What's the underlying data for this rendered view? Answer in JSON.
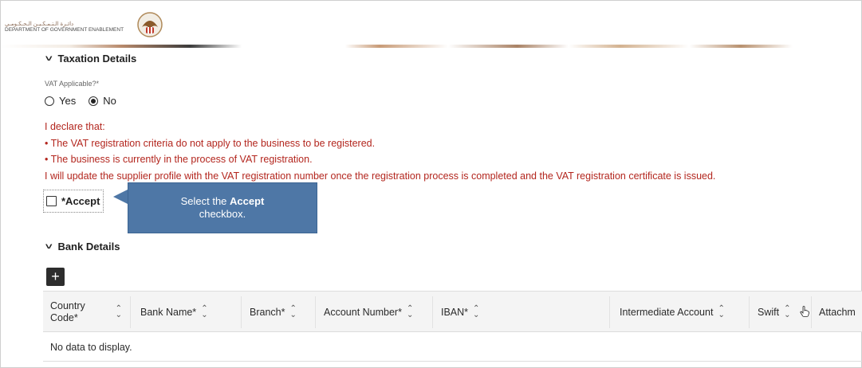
{
  "header": {
    "brand_arabic": "دائـرة الـتـمـكـيـن الـحـكـومـي",
    "brand_english": "DEPARTMENT OF GOVERNMENT ENABLEMENT",
    "emblem_icon": "falcon-emblem-icon"
  },
  "taxation": {
    "section_title": "Taxation Details",
    "vat_label": "VAT Applicable?*",
    "options": [
      "Yes",
      "No"
    ],
    "selected": "No",
    "declaration_lines": [
      "I declare that:",
      "• The VAT registration criteria do not apply to the business to be registered.",
      "• The business is currently in the process of VAT registration.",
      "I will update the supplier profile with the VAT registration number once the registration process is completed and the VAT registration certificate is issued."
    ],
    "accept_label": "*Accept",
    "accept_checked": false
  },
  "callout": {
    "prefix": "Select the ",
    "bold": "Accept",
    "suffix": "checkbox."
  },
  "bank": {
    "section_title": "Bank Details",
    "add_label": "+",
    "columns": [
      {
        "label": "Country Code*"
      },
      {
        "label": "Bank Name*"
      },
      {
        "label": "Branch*"
      },
      {
        "label": "Account Number*"
      },
      {
        "label": "IBAN*"
      },
      {
        "label": "Intermediate Account"
      },
      {
        "label": "Swift"
      },
      {
        "label": "Attachm"
      }
    ],
    "empty_text": "No data to display."
  },
  "colors": {
    "declaration": "#b3261e",
    "callout": "#4e77a6",
    "header_stripe_accent": "#b88a6c"
  }
}
